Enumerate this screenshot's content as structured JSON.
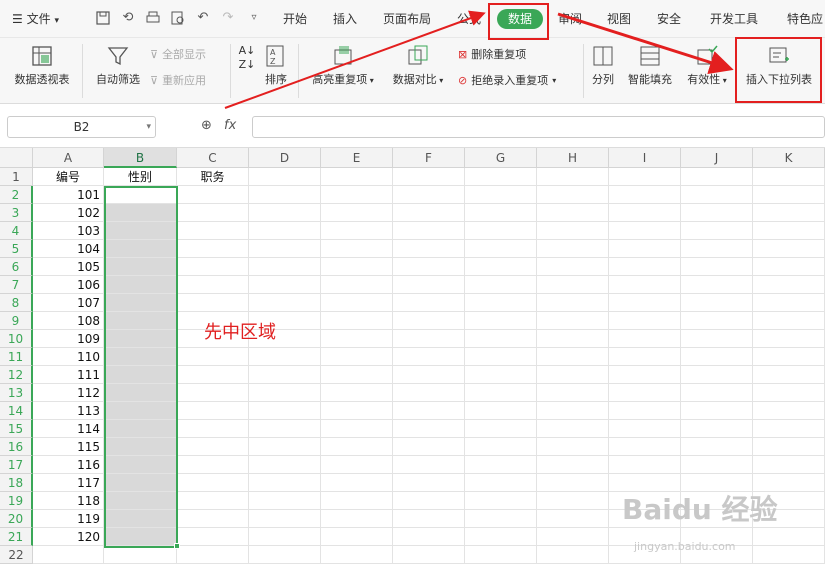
{
  "menubar": {
    "file": "文件",
    "tabs": [
      "开始",
      "插入",
      "页面布局",
      "公式",
      "数据",
      "审阅",
      "视图",
      "安全",
      "开发工具",
      "特色应"
    ]
  },
  "ribbon": {
    "pivot": "数据透视表",
    "autofilter": "自动筛选",
    "show_all": "全部显示",
    "reapply": "重新应用",
    "sort": "排序",
    "highlight_dup": "高亮重复项",
    "compare": "数据对比",
    "delete_dup": "删除重复项",
    "reject_dup": "拒绝录入重复项",
    "split": "分列",
    "smart_fill": "智能填充",
    "validity": "有效性",
    "insert_dropdown": "插入下拉列表"
  },
  "formula": {
    "namebox": "B2",
    "fx": "fx"
  },
  "grid": {
    "columns": [
      "A",
      "B",
      "C",
      "D",
      "E",
      "F",
      "G",
      "H",
      "I",
      "J",
      "K"
    ],
    "rows": [
      "1",
      "2",
      "3",
      "4",
      "5",
      "6",
      "7",
      "8",
      "9",
      "10",
      "11",
      "12",
      "13",
      "14",
      "15",
      "16",
      "17",
      "18",
      "19",
      "20",
      "21",
      "22"
    ],
    "headers": {
      "A": "编号",
      "B": "性别",
      "C": "职务"
    },
    "ids": [
      "101",
      "102",
      "103",
      "104",
      "105",
      "106",
      "107",
      "108",
      "109",
      "110",
      "111",
      "112",
      "113",
      "114",
      "115",
      "116",
      "117",
      "118",
      "119",
      "120"
    ]
  },
  "annotation": "先中区域",
  "watermark": {
    "brand": "Baidu 经验",
    "url": "jingyan.baidu.com"
  },
  "colors": {
    "accent": "#3aa757",
    "highlight": "#e31f1f"
  }
}
